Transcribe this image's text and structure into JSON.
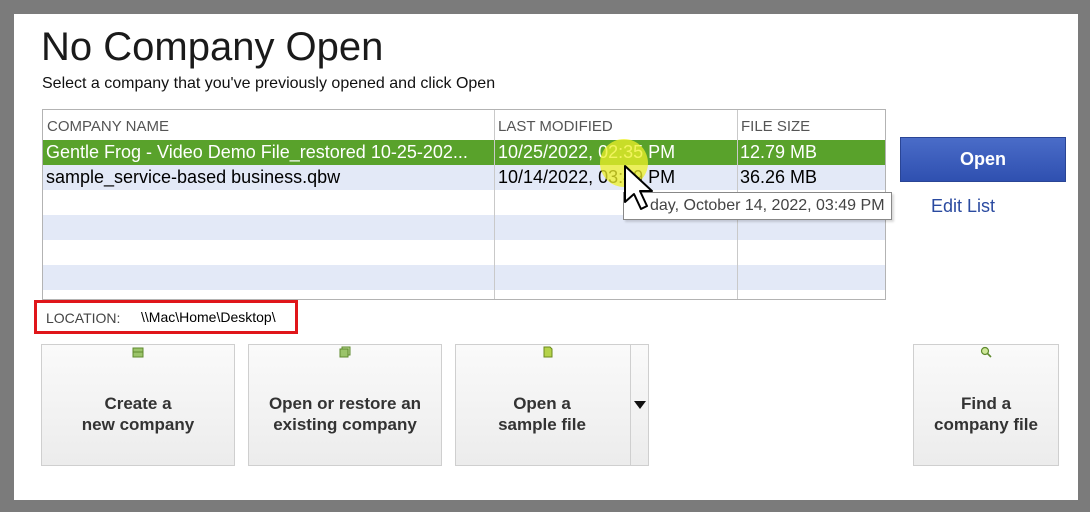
{
  "header": {
    "title": "No Company Open",
    "subtitle": "Select a company that you've previously opened and click Open"
  },
  "table": {
    "columns": [
      "COMPANY NAME",
      "LAST MODIFIED",
      "FILE SIZE"
    ],
    "rows": [
      {
        "name": "Gentle Frog - Video Demo File_restored 10-25-202...",
        "modified": "10/25/2022, 02:35 PM",
        "size": "12.79 MB",
        "selected": true
      },
      {
        "name": "sample_service-based business.qbw",
        "modified": "10/14/2022, 03:49 PM",
        "size": "36.26 MB",
        "selected": false
      }
    ],
    "tooltip": "day, October 14, 2022, 03:49 PM"
  },
  "actions": {
    "open_label": "Open",
    "edit_list_label": "Edit List"
  },
  "location": {
    "label": "LOCATION:",
    "value": "\\\\Mac\\Home\\Desktop\\"
  },
  "tiles": {
    "create": "Create a\nnew company",
    "open_restore": "Open or restore an\nexisting company",
    "sample": "Open a\nsample file",
    "find": "Find a\ncompany file"
  },
  "colors": {
    "selected_row": "#59a22b",
    "alt_row": "#e3e9f7",
    "open_button": "#3a5cbc",
    "location_highlight": "#e0161a"
  },
  "icons": {
    "create": "file-cabinet-icon",
    "open_restore": "folder-stack-icon",
    "sample": "document-icon",
    "find": "magnifier-icon"
  }
}
